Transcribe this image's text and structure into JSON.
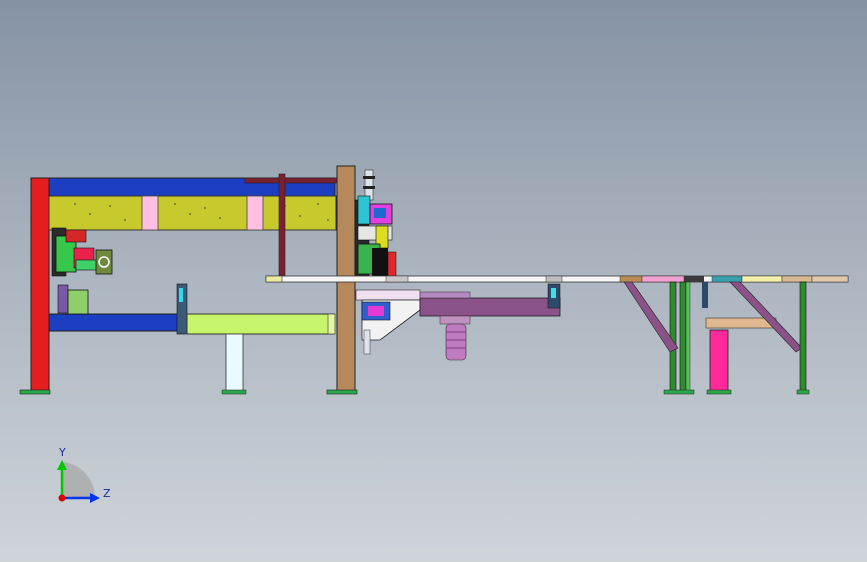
{
  "triad": {
    "y_label": "Y",
    "z_label": "Z",
    "y_color": "#00c800",
    "z_color": "#0033ee",
    "origin_color": "#e00000"
  },
  "colors": {
    "column": "#e41e1e",
    "top_beam": "#1c3ec0",
    "lattice": "#c7c92c",
    "pink": "#ffbfe0",
    "wood": "#b5895c",
    "lime": "#c6f56c",
    "green": "#2e8b2e",
    "purple": "#8a5288",
    "magenta": "#ff2a9a"
  }
}
